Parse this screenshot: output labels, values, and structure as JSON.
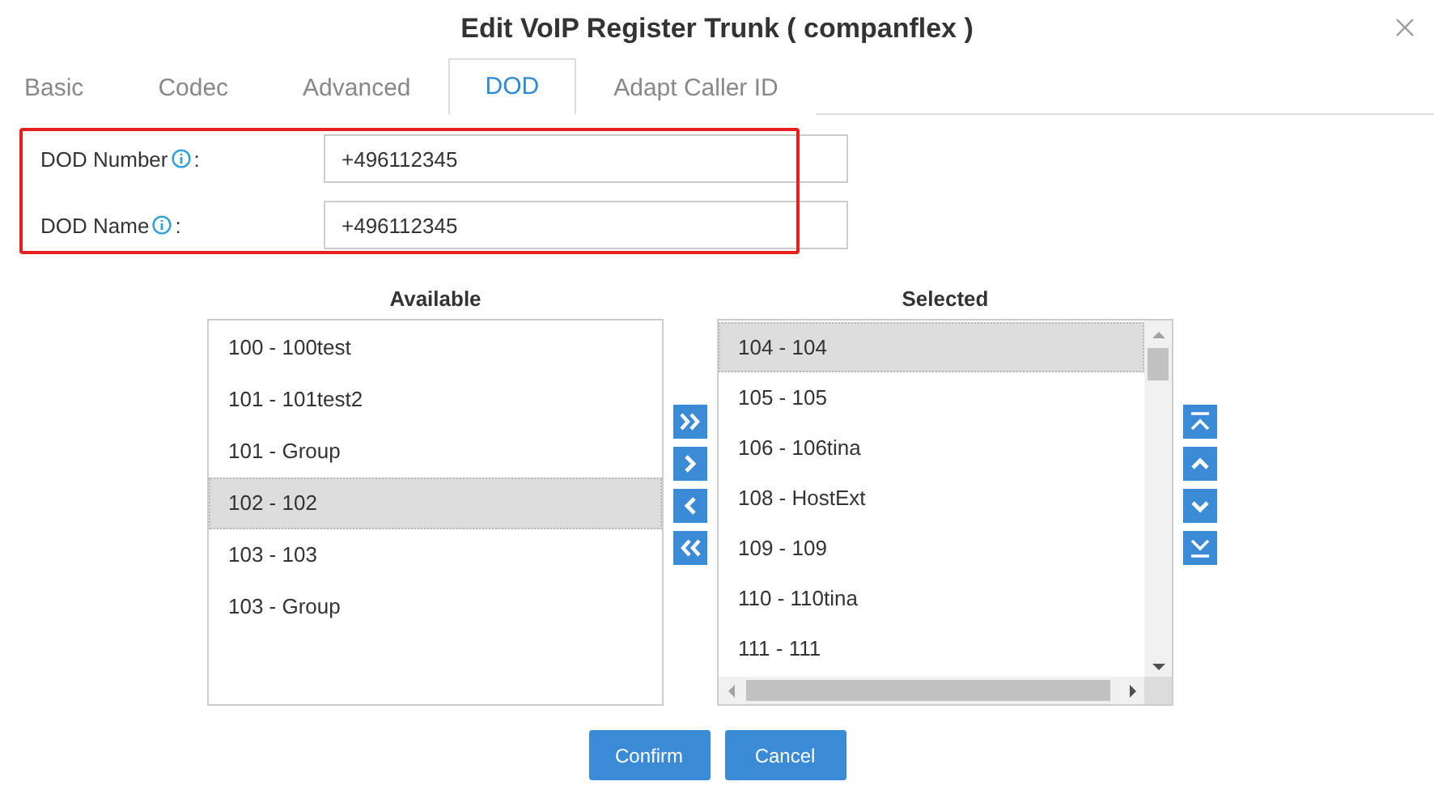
{
  "dialog": {
    "title": "Edit VoIP Register Trunk ( companflex )"
  },
  "tabs": [
    {
      "label": "Basic",
      "selected": false
    },
    {
      "label": "Codec",
      "selected": false
    },
    {
      "label": "Advanced",
      "selected": false
    },
    {
      "label": "DOD",
      "selected": true
    },
    {
      "label": "Adapt Caller ID",
      "selected": false
    }
  ],
  "fields": [
    {
      "label": "DOD Number",
      "suffix": ":",
      "value": "+496112345"
    },
    {
      "label": "DOD Name",
      "suffix": ":",
      "value": "+496112345"
    }
  ],
  "available": {
    "heading": "Available",
    "items": [
      {
        "label": "100 - 100test",
        "selected": false
      },
      {
        "label": "101 - 101test2",
        "selected": false
      },
      {
        "label": "101 - Group",
        "selected": false
      },
      {
        "label": "102 - 102",
        "selected": true
      },
      {
        "label": "103 - 103",
        "selected": false
      },
      {
        "label": "103 - Group",
        "selected": false
      }
    ]
  },
  "selected_list": {
    "heading": "Selected",
    "items": [
      {
        "label": "104 - 104",
        "selected": true
      },
      {
        "label": "105 - 105",
        "selected": false
      },
      {
        "label": "106 - 106tina",
        "selected": false
      },
      {
        "label": "108 - HostExt",
        "selected": false
      },
      {
        "label": "109 - 109",
        "selected": false
      },
      {
        "label": "110 - 110tina",
        "selected": false
      },
      {
        "label": "111 - 111",
        "selected": false
      }
    ]
  },
  "buttons": [
    {
      "label": "Confirm"
    },
    {
      "label": "Cancel"
    }
  ]
}
